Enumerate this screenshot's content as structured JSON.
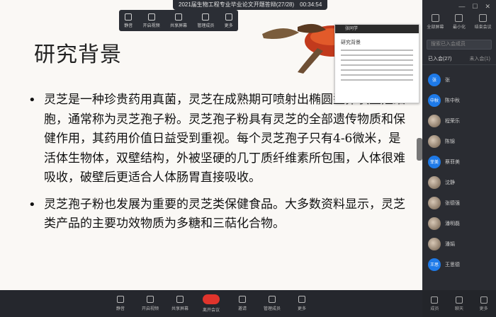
{
  "meeting": {
    "title": "2021届生物工程专业毕业论文开题答辩(27/28)　00:34:54"
  },
  "slide": {
    "title": "研究背景",
    "bullets": [
      "灵芝是一种珍贵药用真菌，灵芝在成熟期可喷射出椭圆型卵状生殖细胞，通常称为灵芝孢子粉。灵芝孢子粉具有灵芝的全部遗传物质和保健作用，其药用价值日益受到重视。每个灵芝孢子只有4-6微米，是活体生物体，双壁结构，外被坚硬的几丁质纤维素所包围，人体很难吸收，破壁后更适合人体肠胃直接吸收。",
      "灵芝孢子粉也发展为重要的灵芝类保健食品。大多数资料显示，灵芝类产品的主要功效物质为多糖和三萜化合物。"
    ]
  },
  "thumbnail": {
    "header": "张同学",
    "title": "研究背景"
  },
  "topbar": {
    "buttons": [
      "静音",
      "开启视频",
      "共享屏幕",
      "管理成员",
      "更多"
    ]
  },
  "panel": {
    "tools": [
      "全部屏幕",
      "最小化",
      "结束会议"
    ],
    "search_placeholder": "搜索已入会成员",
    "tab_joined": "已入会(27)",
    "tab_other": "未入会(1)",
    "participants": [
      {
        "name": "张",
        "avatar": "张",
        "style": "blue"
      },
      {
        "name": "陈中秋",
        "avatar": "中秋",
        "style": "blue"
      },
      {
        "name": "程荣乐",
        "avatar": "",
        "style": "photo"
      },
      {
        "name": "陈锦",
        "avatar": "",
        "style": "photo"
      },
      {
        "name": "蔡菲美",
        "avatar": "菲美",
        "style": "blue"
      },
      {
        "name": "沈静",
        "avatar": "",
        "style": "photo"
      },
      {
        "name": "张德强",
        "avatar": "",
        "style": "photo"
      },
      {
        "name": "潘明磊",
        "avatar": "",
        "style": "photo"
      },
      {
        "name": "潘娟",
        "avatar": "",
        "style": "photo"
      },
      {
        "name": "王思德",
        "avatar": "王思",
        "style": "blue"
      }
    ]
  },
  "bottombar": {
    "buttons": [
      "静音",
      "开启视频",
      "共享屏幕",
      "离开会议",
      "邀请",
      "管理成员",
      "更多"
    ]
  },
  "panelbottom": {
    "buttons": [
      "成员",
      "聊天",
      "更多"
    ]
  },
  "colors": {
    "end_call": "#e0342c",
    "avatar_blue": "#1e7ae8"
  }
}
